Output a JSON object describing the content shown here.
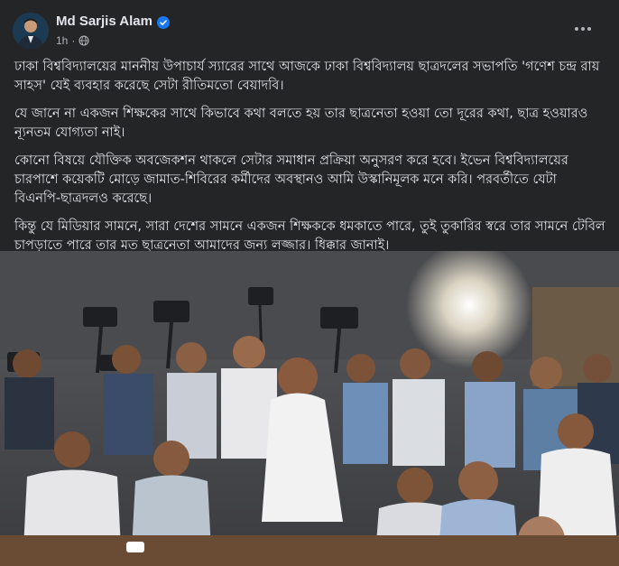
{
  "post": {
    "author": "Md Sarjis Alam",
    "time": "1h",
    "separator": "·",
    "paragraphs": [
      "ঢাকা বিশ্ববিদ্যালয়ের মাননীয় উপাচার্য স্যারের সাথে আজকে ঢাকা বিশ্ববিদ্যালয় ছাত্রদলের সভাপতি 'গণেশ চন্দ্র রায় সাহস' যেই ব্যবহার করেছে সেটা রীতিমতো বেয়াদবি।",
      "যে জানে না একজন শিক্ষকের সাথে কিভাবে কথা বলতে হয় তার ছাত্রনেতা হওয়া তো দূরের কথা, ছাত্র হওয়ারও ন্যূনতম যোগ্যতা নাই।",
      "কোনো বিষয়ে যৌক্তিক অবজেকশন থাকলে সেটার সমাধান প্রক্রিয়া অনুসরণ করে হবে। ইভেন বিশ্ববিদ্যালয়ের চারপাশে কয়েকটি মোড়ে জামাত-শিবিরের কর্মীদের অবস্থানও আমি উস্কানিমূলক মনে করি। পরবর্তীতে যেটা বিএনপি-ছাত্রদলও করেছে।",
      "কিন্তু যে মিডিয়ার সামনে, সারা দেশের সামনে একজন শিক্ষককে ধমকাতে পারে, তুই তুকারির স্বরে তার সামনে টেবিল চাপড়াতে পারে তার মত ছাত্রনেতা আমাদের জন্য লজ্জার। ধিক্কার জানাই।"
    ]
  },
  "icons": {
    "verified": "verified-badge-icon",
    "privacy": "globe-icon",
    "more": "more-options-icon"
  },
  "colors": {
    "background": "#242526",
    "text_primary": "#e4e6eb",
    "text_secondary": "#b0b3b8",
    "verified_blue": "#1877f2"
  }
}
